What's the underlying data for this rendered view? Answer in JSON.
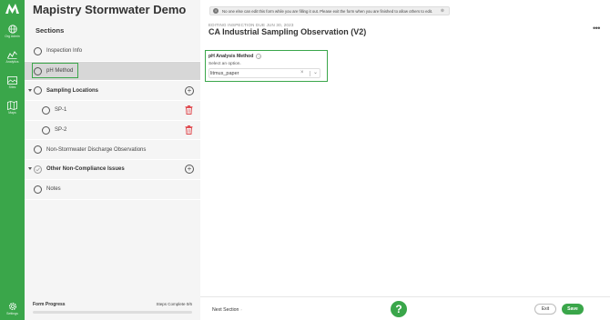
{
  "rail": {
    "items": [
      {
        "label": "Org Admin",
        "icon": "globe-icon"
      },
      {
        "label": "Analytics",
        "icon": "analytics-icon"
      },
      {
        "label": "Sites",
        "icon": "sites-icon"
      },
      {
        "label": "Maps",
        "icon": "map-icon"
      },
      {
        "label": "Settings",
        "icon": "gear-icon"
      }
    ],
    "color": "#3aa64a"
  },
  "sidebar": {
    "app_title": "Mapistry Stormwater Demo",
    "sections_heading": "Sections",
    "items": [
      {
        "label": "Inspection Info"
      },
      {
        "label": "pH Method"
      },
      {
        "label": "Sampling Locations"
      },
      {
        "label": "SP-1"
      },
      {
        "label": "SP-2"
      },
      {
        "label": "Non-Stormwater Discharge Observations"
      },
      {
        "label": "Other Non-Compliance Issues"
      },
      {
        "label": "Notes"
      }
    ],
    "progress": {
      "label": "Form Progress",
      "status": "Steps Complete 0/6",
      "value": 0
    }
  },
  "main": {
    "notice": "No one else can edit this form while you are filling it out. Please exit the form when you are finished to allow others to edit.",
    "due": "EDITING INSPECTION DUE JUN 30, 2023",
    "form_title": "CA Industrial Sampling Observation (V2)",
    "more": "•••",
    "field": {
      "label": "pH Analysis Method",
      "help": "Select an option.",
      "value": "litmus_paper",
      "clear": "×",
      "chevron": "⌄"
    }
  },
  "footer": {
    "next": "Next Section",
    "exit": "Exit",
    "save": "Save",
    "help": "?"
  },
  "colors": {
    "accent": "#3aa64a",
    "trash": "#e0474c"
  }
}
